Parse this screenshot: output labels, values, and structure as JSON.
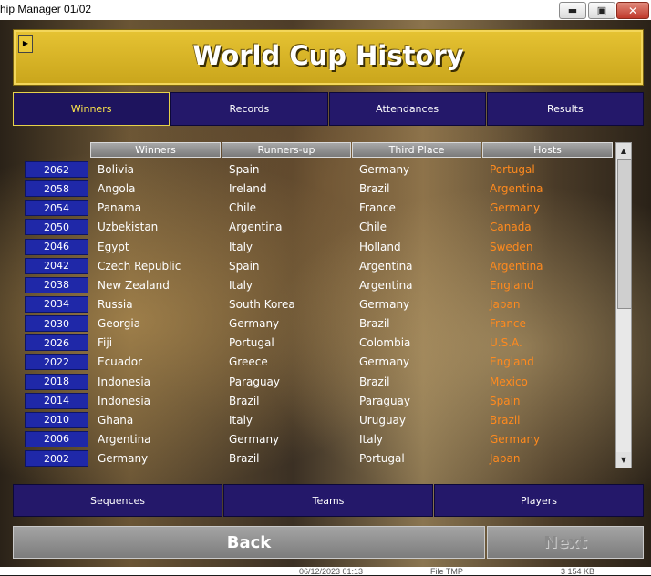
{
  "window": {
    "title": "hip Manager 01/02",
    "controls": {
      "minimize_icon": "minimize-icon",
      "maximize_icon": "maximize-icon",
      "close_icon": "close-icon"
    }
  },
  "header": {
    "title": "World Cup History"
  },
  "tabs": [
    {
      "label": "Winners",
      "active": true
    },
    {
      "label": "Records",
      "active": false
    },
    {
      "label": "Attendances",
      "active": false
    },
    {
      "label": "Results",
      "active": false
    }
  ],
  "table": {
    "columns": [
      "Winners",
      "Runners-up",
      "Third Place",
      "Hosts"
    ],
    "rows": [
      {
        "year": "2062",
        "winners": "Bolivia",
        "runners_up": "Spain",
        "third": "Germany",
        "hosts": "Portugal"
      },
      {
        "year": "2058",
        "winners": "Angola",
        "runners_up": "Ireland",
        "third": "Brazil",
        "hosts": "Argentina"
      },
      {
        "year": "2054",
        "winners": "Panama",
        "runners_up": "Chile",
        "third": "France",
        "hosts": "Germany"
      },
      {
        "year": "2050",
        "winners": "Uzbekistan",
        "runners_up": "Argentina",
        "third": "Chile",
        "hosts": "Canada"
      },
      {
        "year": "2046",
        "winners": "Egypt",
        "runners_up": "Italy",
        "third": "Holland",
        "hosts": "Sweden"
      },
      {
        "year": "2042",
        "winners": "Czech Republic",
        "runners_up": "Spain",
        "third": "Argentina",
        "hosts": "Argentina"
      },
      {
        "year": "2038",
        "winners": "New Zealand",
        "runners_up": "Italy",
        "third": "Argentina",
        "hosts": "England"
      },
      {
        "year": "2034",
        "winners": "Russia",
        "runners_up": "South Korea",
        "third": "Germany",
        "hosts": "Japan"
      },
      {
        "year": "2030",
        "winners": "Georgia",
        "runners_up": "Germany",
        "third": "Brazil",
        "hosts": "France"
      },
      {
        "year": "2026",
        "winners": "Fiji",
        "runners_up": "Portugal",
        "third": "Colombia",
        "hosts": "U.S.A."
      },
      {
        "year": "2022",
        "winners": "Ecuador",
        "runners_up": "Greece",
        "third": "Germany",
        "hosts": "England"
      },
      {
        "year": "2018",
        "winners": "Indonesia",
        "runners_up": "Paraguay",
        "third": "Brazil",
        "hosts": "Mexico"
      },
      {
        "year": "2014",
        "winners": "Indonesia",
        "runners_up": "Brazil",
        "third": "Paraguay",
        "hosts": "Spain"
      },
      {
        "year": "2010",
        "winners": "Ghana",
        "runners_up": "Italy",
        "third": "Uruguay",
        "hosts": "Brazil"
      },
      {
        "year": "2006",
        "winners": "Argentina",
        "runners_up": "Germany",
        "third": "Italy",
        "hosts": "Germany"
      },
      {
        "year": "2002",
        "winners": "Germany",
        "runners_up": "Brazil",
        "third": "Portugal",
        "hosts": "Japan"
      }
    ]
  },
  "bottom_buttons": [
    "Sequences",
    "Teams",
    "Players"
  ],
  "nav": {
    "back": "Back",
    "next": "Next"
  },
  "footer": {
    "date": "06/12/2023 01:13",
    "type": "File TMP",
    "size": "3 154 KB"
  },
  "colors": {
    "banner": "#d9b526",
    "tab_bg": "#24186a",
    "active_tab_text": "#ffe94a",
    "year_bg": "#1f28a8",
    "host_text": "#ff8a1e"
  }
}
